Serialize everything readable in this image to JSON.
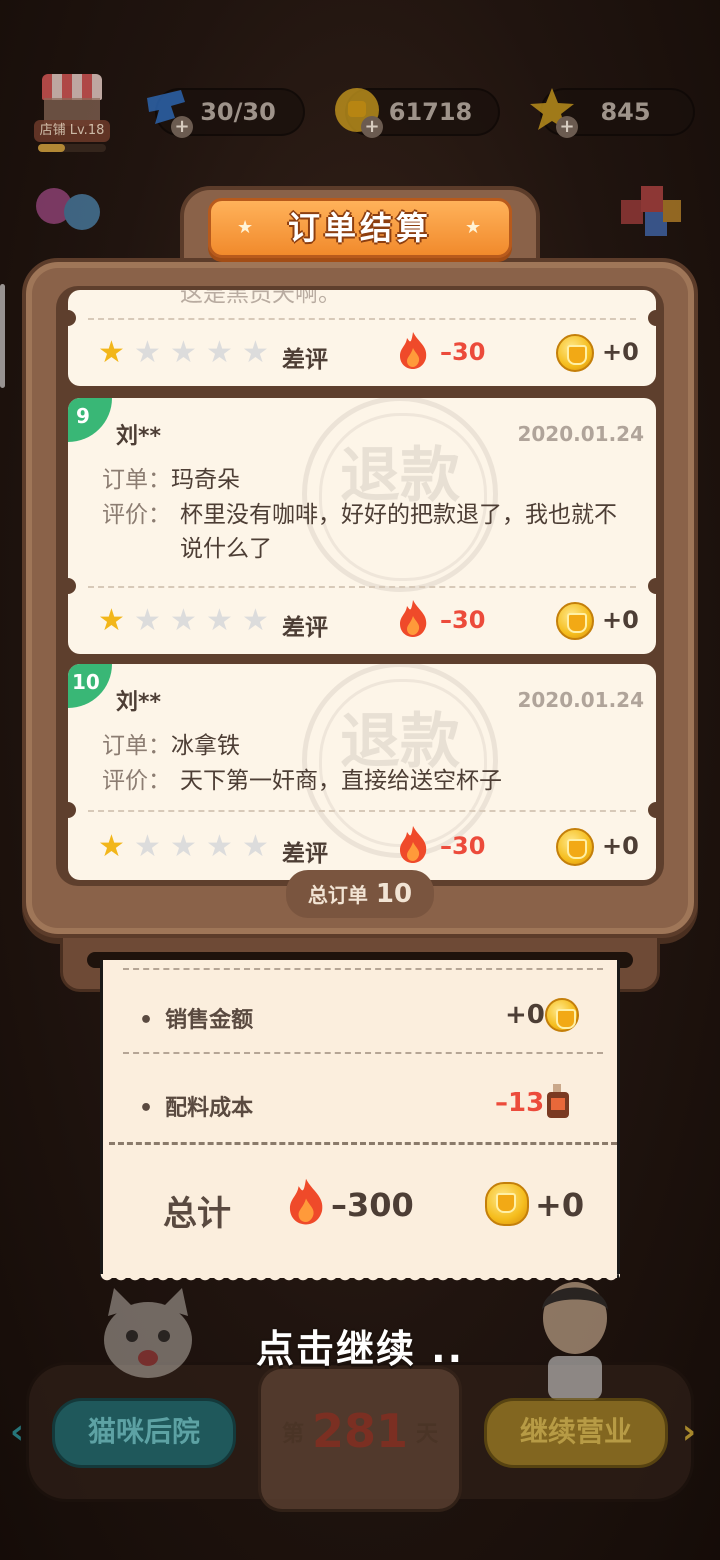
{
  "hud": {
    "shop_level": "店铺 Lv.18",
    "energy": "30/30",
    "coins": "61718",
    "stars": "845"
  },
  "panel": {
    "title": "订单结算",
    "total_orders_label": "总订单",
    "total_orders_value": "10"
  },
  "partial_card": {
    "clipped_text": "这是黑员天啊。",
    "rating_label": "差评",
    "penalty": "–30",
    "bonus": "+0",
    "stars_filled": 1,
    "stars_total": 5
  },
  "orders": [
    {
      "index": "9",
      "customer": "刘**",
      "date": "2020.01.24",
      "order_label": "订单：",
      "order_item": "玛奇朵",
      "review_label": "评价：",
      "review_text": "杯里没有咖啡，好好的把款退了，我也就不说什么了",
      "stamp": "退款",
      "rating_label": "差评",
      "penalty": "–30",
      "bonus": "+0",
      "stars_filled": 1,
      "stars_total": 5
    },
    {
      "index": "10",
      "customer": "刘**",
      "date": "2020.01.24",
      "order_label": "订单：",
      "order_item": "冰拿铁",
      "review_label": "评价：",
      "review_text": "天下第一奸商，直接给送空杯子",
      "stamp": "退款",
      "rating_label": "差评",
      "penalty": "–30",
      "bonus": "+0",
      "stars_filled": 1,
      "stars_total": 5
    }
  ],
  "receipt": {
    "sales_label": "销售金额",
    "sales_value": "+0",
    "ingredients_label": "配料成本",
    "ingredients_value": "–13",
    "total_label": "总计",
    "total_penalty": "–300",
    "total_bonus": "+0"
  },
  "bottom": {
    "tap_continue": "点击继续 ..",
    "left_button": "猫咪后院",
    "right_button": "继续营业",
    "day_prefix": "第",
    "day_number": "281",
    "day_suffix": "天"
  },
  "colors": {
    "penalty": "#ec4b3b",
    "badge": "#39b776",
    "ribbon": "#f18a2c"
  }
}
